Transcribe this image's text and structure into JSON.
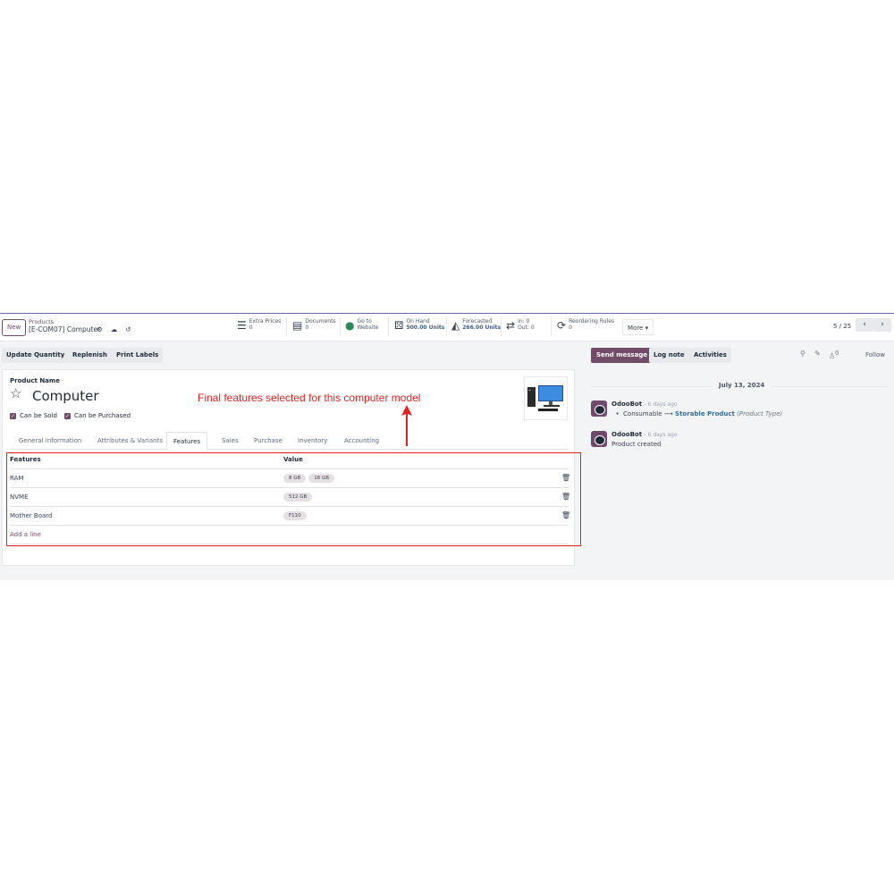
{
  "control_panel": {
    "new_label": "New",
    "breadcrumb_parent": "Products",
    "breadcrumb_current": "[E-COM07] Computer",
    "smart_buttons": [
      {
        "label": "Extra Prices",
        "value": "0"
      },
      {
        "label": "Documents",
        "value": "0"
      },
      {
        "label": "Go to",
        "value": "Website"
      },
      {
        "label": "On Hand",
        "value": "500.00 Units"
      },
      {
        "label": "Forecasted",
        "value": "266.00 Units"
      },
      {
        "label": "In: 0",
        "value": "Out: 0"
      },
      {
        "label": "Reordering Rules",
        "value": "0"
      }
    ],
    "more_label": "More ▾",
    "pager": "5 / 25"
  },
  "actions": {
    "update_quantity": "Update Quantity",
    "replenish": "Replenish",
    "print_labels": "Print Labels"
  },
  "form": {
    "product_name_label": "Product Name",
    "product_name": "Computer",
    "can_be_sold": "Can be Sold",
    "can_be_purchased": "Can be Purchased",
    "tabs": [
      "General Information",
      "Attributes & Variants",
      "Features",
      "Sales",
      "Purchase",
      "Inventory",
      "Accounting"
    ],
    "active_tab": "Features"
  },
  "features_table": {
    "headers": {
      "feature": "Features",
      "value": "Value"
    },
    "rows": [
      {
        "feature": "RAM",
        "values": [
          "8 GB",
          "16 GB"
        ]
      },
      {
        "feature": "NVME",
        "values": [
          "512 GB"
        ]
      },
      {
        "feature": "Mother Board",
        "values": [
          "F110"
        ]
      }
    ],
    "add_line": "Add a line"
  },
  "annotation": "Final features selected for this computer model",
  "chatter": {
    "send_message": "Send message",
    "log_note": "Log note",
    "activities": "Activities",
    "follower_count": "0",
    "follow": "Follow",
    "date_separator": "July 13, 2024",
    "messages": [
      {
        "author": "OdooBot",
        "when": "- 6 days ago",
        "old_value": "Consumable",
        "new_value": "Storable Product",
        "field": "(Product Type)"
      },
      {
        "author": "OdooBot",
        "when": "- 6 days ago",
        "text": "Product created"
      }
    ]
  },
  "colors": {
    "brand": "#714b67",
    "annotation": "#e81f1f",
    "link": "#2f6f99"
  }
}
